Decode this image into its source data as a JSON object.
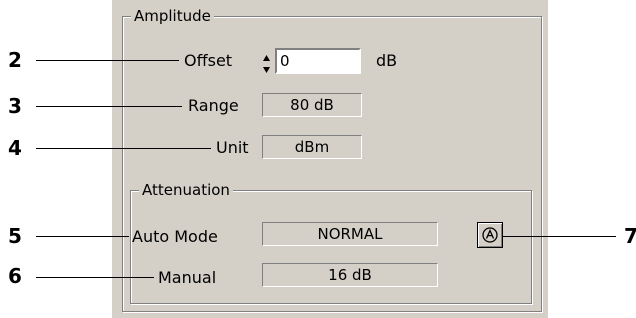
{
  "amplitude": {
    "group_title": "Amplitude",
    "offset": {
      "label": "Offset",
      "value": "0",
      "unit": "dB"
    },
    "range": {
      "label": "Range",
      "value": "80 dB"
    },
    "unit": {
      "label": "Unit",
      "value": "dBm"
    }
  },
  "attenuation": {
    "group_title": "Attenuation",
    "auto_mode": {
      "label": "Auto Mode",
      "value": "NORMAL",
      "button_icon": "auto-mode-icon"
    },
    "manual": {
      "label": "Manual",
      "value": "16 dB"
    }
  },
  "callouts": [
    "2",
    "3",
    "4",
    "5",
    "6",
    "7"
  ]
}
